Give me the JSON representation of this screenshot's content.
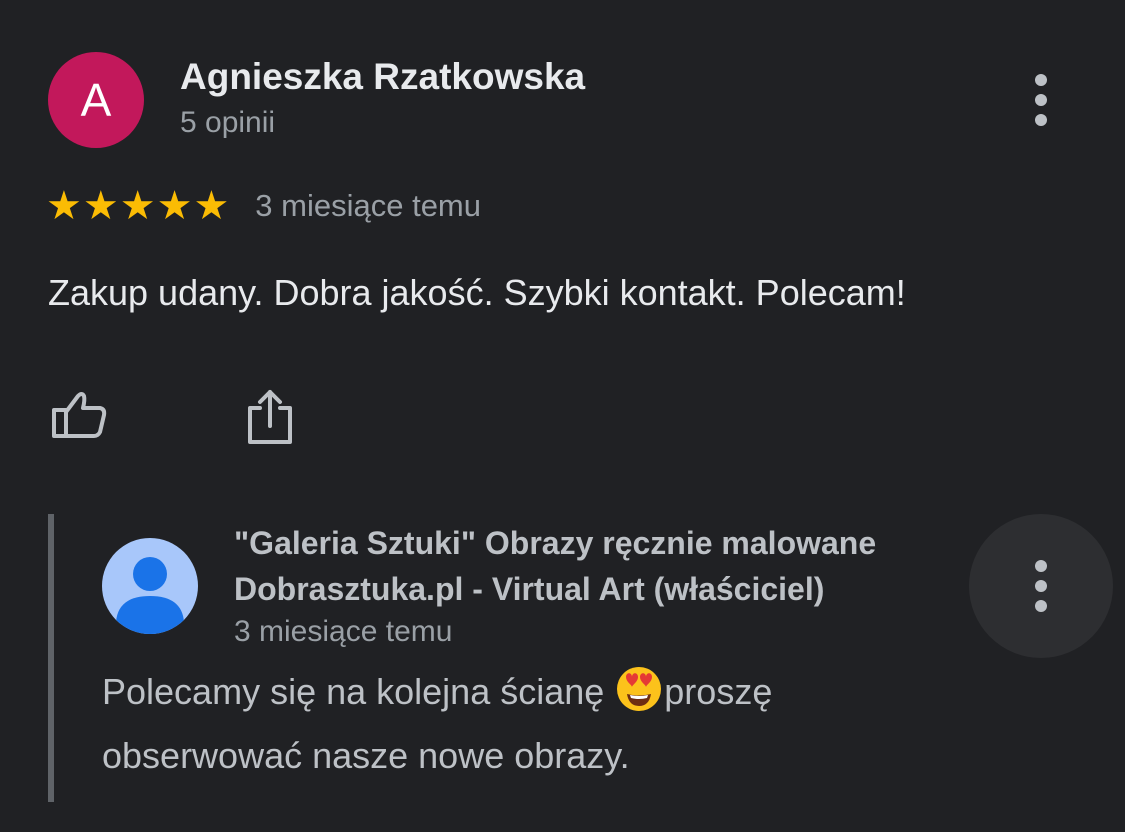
{
  "review": {
    "avatar_letter": "A",
    "avatar_color": "#c2185b",
    "author": "Agnieszka Rzatkowska",
    "review_count": "5 opinii",
    "rating": 5,
    "rating_max": 5,
    "star_color": "#fbbc04",
    "date": "3 miesiące temu",
    "text": "Zakup udany. Dobra jakość. Szybki kontakt. Polecam!",
    "actions": [
      "thumb-up-icon",
      "share-icon"
    ]
  },
  "owner_reply": {
    "owner_name": "\"Galeria Sztuki\" Obrazy ręcznie malowane Dobrasztuka.pl - Virtual Art (właściciel)",
    "date": "3 miesiące temu",
    "text_before_emoji": "Polecamy się na kolejna ścianę ",
    "emoji": "smiling-face-with-heart-eyes-emoji",
    "text_after_emoji": "proszę obserwować nasze nowe obrazy."
  }
}
